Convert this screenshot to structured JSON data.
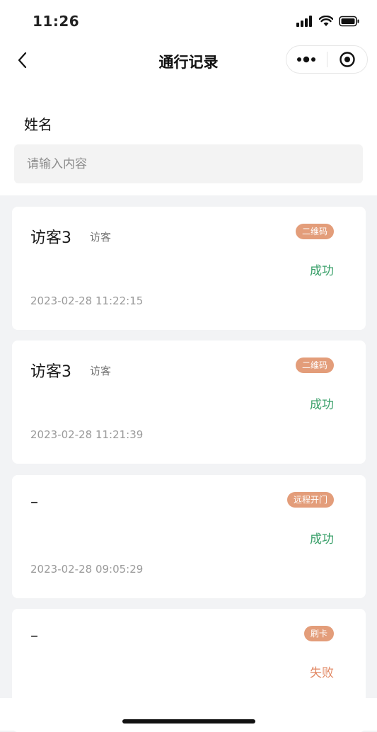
{
  "status_bar": {
    "time": "11:26"
  },
  "nav": {
    "title": "通行记录"
  },
  "search": {
    "label": "姓名",
    "placeholder": "请输入内容",
    "value": ""
  },
  "records": [
    {
      "name": "访客3",
      "role": "访客",
      "method": "二维码",
      "status": "成功",
      "time": "2023-02-28 11:22:15"
    },
    {
      "name": "访客3",
      "role": "访客",
      "method": "二维码",
      "status": "成功",
      "time": "2023-02-28 11:21:39"
    },
    {
      "name": "–",
      "role": "",
      "method": "远程开门",
      "status": "成功",
      "time": "2023-02-28 09:05:29"
    },
    {
      "name": "–",
      "role": "",
      "method": "刷卡",
      "status": "失败",
      "time": ""
    }
  ],
  "colors": {
    "tag_bg": "#e39d7a",
    "success": "#3aa06a",
    "fail": "#e28965",
    "page_bg": "#f2f3f5"
  },
  "icons": {
    "back": "chevron-left-icon",
    "more": "more-dots-icon",
    "close": "target-circle-icon",
    "signal": "signal-icon",
    "wifi": "wifi-icon",
    "battery": "battery-icon"
  }
}
